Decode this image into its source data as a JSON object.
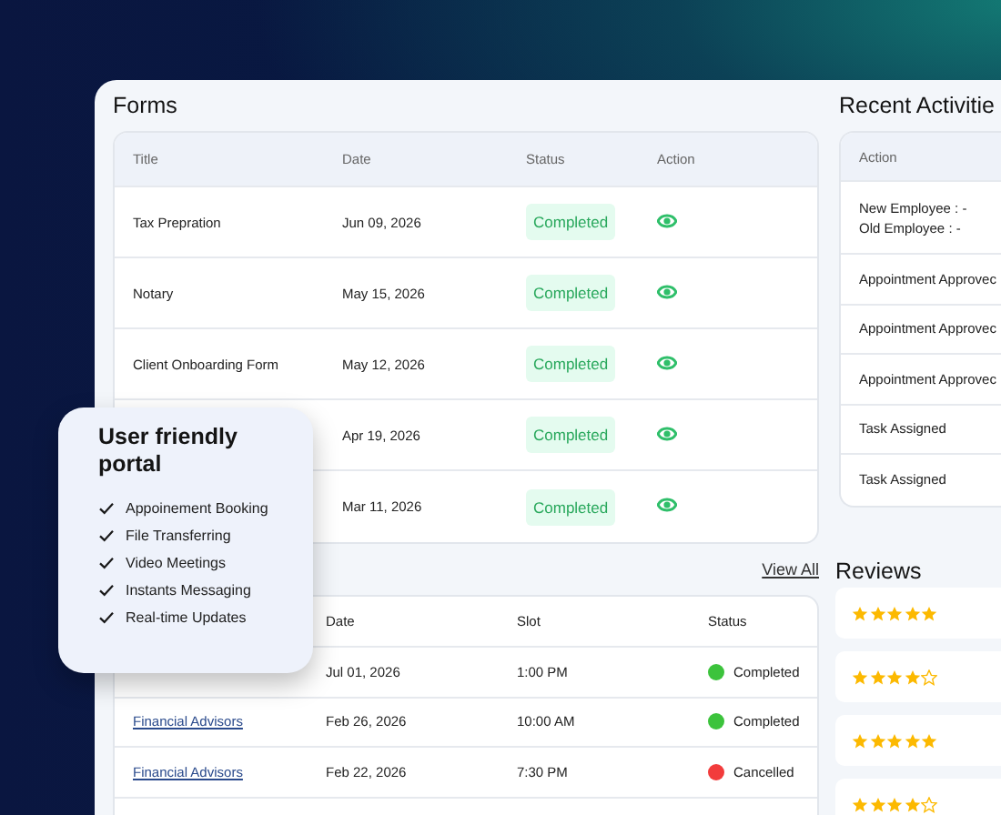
{
  "forms": {
    "title": "Forms",
    "columns": [
      "Title",
      "Date",
      "Status",
      "Action"
    ],
    "rows": [
      {
        "title": "Tax Prepration",
        "date": "Jun 09, 2026",
        "status": "Completed"
      },
      {
        "title": "Notary",
        "date": "May 15, 2026",
        "status": "Completed"
      },
      {
        "title": "Client Onboarding Form",
        "date": "May 12, 2026",
        "status": "Completed"
      },
      {
        "date": "Apr 19, 2026",
        "status": "Completed"
      },
      {
        "date": "Mar 11, 2026",
        "status": "Completed"
      }
    ]
  },
  "recent_activities": {
    "title": "Recent Activitie",
    "column": "Action",
    "rows": [
      {
        "lines": [
          "New Employee : -",
          "Old Employee : -"
        ]
      },
      {
        "lines": [
          "Appointment Approvec"
        ]
      },
      {
        "lines": [
          "Appointment Approvec"
        ]
      },
      {
        "lines": [
          "Appointment Approvec"
        ]
      },
      {
        "lines": [
          "Task Assigned"
        ]
      },
      {
        "lines": [
          "Task Assigned"
        ]
      }
    ]
  },
  "appointments": {
    "view_all": "View All",
    "columns": [
      "Date",
      "Slot",
      "Status"
    ],
    "rows": [
      {
        "date": "Jul 01, 2026",
        "slot": "1:00 PM",
        "status": "Completed",
        "color": "#3cc33c"
      },
      {
        "title": "Financial Advisors",
        "date": "Feb 26, 2026",
        "slot": "10:00 AM",
        "status": "Completed",
        "color": "#3cc33c"
      },
      {
        "title": "Financial Advisors",
        "date": "Feb 22, 2026",
        "slot": "7:30 PM",
        "status": "Cancelled",
        "color": "#f23c3c"
      }
    ]
  },
  "reviews": {
    "title": "Reviews",
    "items": [
      {
        "stars": 5
      },
      {
        "stars": 4
      },
      {
        "stars": 5
      },
      {
        "stars": 4
      }
    ]
  },
  "feature_card": {
    "title": "User friendly portal",
    "features": [
      "Appoinement Booking",
      "File Transferring",
      "Video Meetings",
      "Instants Messaging",
      "Real-time Updates"
    ]
  }
}
